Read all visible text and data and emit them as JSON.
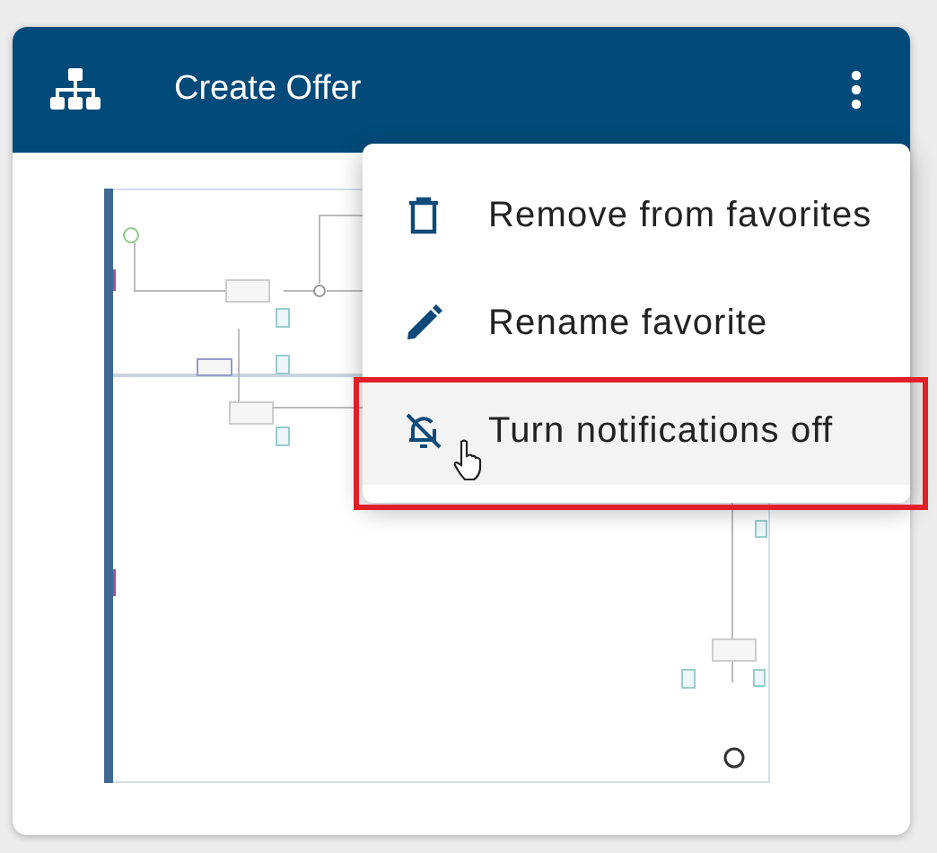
{
  "card": {
    "title": "Create Offer"
  },
  "menu": {
    "items": [
      {
        "kind": "delete",
        "label": "Remove from favorites",
        "hovered": false,
        "outlined": false,
        "cursor": false
      },
      {
        "kind": "rename",
        "label": "Rename favorite",
        "hovered": false,
        "outlined": false,
        "cursor": false
      },
      {
        "kind": "mute",
        "label": "Turn notifications off",
        "hovered": true,
        "outlined": true,
        "cursor": true
      }
    ]
  }
}
